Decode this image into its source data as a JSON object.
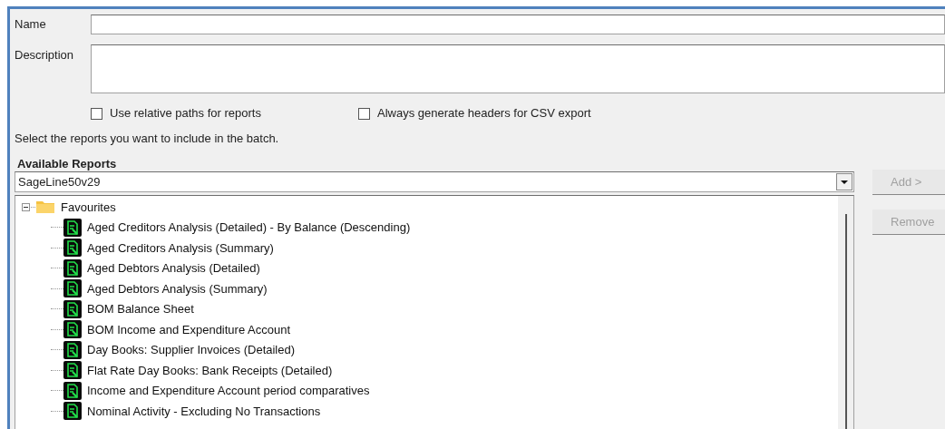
{
  "form": {
    "name_label": "Name",
    "description_label": "Description"
  },
  "options": [
    {
      "label": "Use relative paths for reports",
      "checked": false
    },
    {
      "label": "Always generate headers for CSV export",
      "checked": false
    }
  ],
  "instruction": "Select the reports you want to include in the batch.",
  "available_reports": {
    "title": "Available Reports",
    "source": "SageLine50v29",
    "tree": [
      {
        "label": "Favourites",
        "kind": "folder",
        "expanded": true,
        "children": [
          {
            "label": "Aged Creditors Analysis (Detailed) - By Balance (Descending)",
            "kind": "report"
          },
          {
            "label": "Aged Creditors Analysis (Summary)",
            "kind": "report"
          },
          {
            "label": "Aged Debtors Analysis (Detailed)",
            "kind": "report"
          },
          {
            "label": "Aged Debtors Analysis (Summary)",
            "kind": "report"
          },
          {
            "label": "BOM Balance Sheet",
            "kind": "report"
          },
          {
            "label": "BOM Income and Expenditure Account",
            "kind": "report"
          },
          {
            "label": "Day Books: Supplier Invoices (Detailed)",
            "kind": "report"
          },
          {
            "label": "Flat Rate Day Books: Bank Receipts (Detailed)",
            "kind": "report"
          },
          {
            "label": "Income and Expenditure Account period comparatives",
            "kind": "report"
          },
          {
            "label": "Nominal Activity - Excluding No Transactions",
            "kind": "report"
          }
        ]
      }
    ]
  },
  "buttons": [
    {
      "label": "Add >",
      "disabled": true
    },
    {
      "label": "Remove",
      "disabled": true
    }
  ]
}
